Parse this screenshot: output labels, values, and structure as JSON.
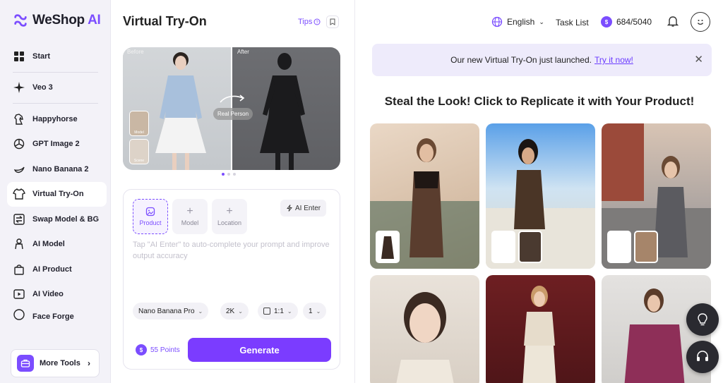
{
  "app": {
    "logo_text": "WeShop",
    "logo_ai": "AI",
    "brand_color": "#7b4dff"
  },
  "sidebar": {
    "items": [
      {
        "label": "Start",
        "icon": "grid-icon"
      },
      {
        "label": "Veo 3",
        "icon": "sparkle-icon"
      },
      {
        "label": "Happyhorse",
        "icon": "horse-icon"
      },
      {
        "label": "GPT Image 2",
        "icon": "openai-icon"
      },
      {
        "label": "Nano Banana 2",
        "icon": "banana-icon"
      },
      {
        "label": "Virtual Try-On",
        "icon": "shirt-icon",
        "active": true
      },
      {
        "label": "Swap Model & BG",
        "icon": "swap-icon"
      },
      {
        "label": "AI Model",
        "icon": "person-icon"
      },
      {
        "label": "AI Product",
        "icon": "bag-icon"
      },
      {
        "label": "AI Video",
        "icon": "video-icon"
      },
      {
        "label": "Face Forge",
        "icon": "face-icon"
      }
    ],
    "more_tools_label": "More Tools"
  },
  "panel": {
    "title": "Virtual Try-On",
    "tips_label": "Tips",
    "preview": {
      "before_label": "Before",
      "after_label": "After",
      "real_person_label": "Real Person",
      "model_thumb_label": "Model",
      "scene_thumb_label": "Scene"
    },
    "slots": [
      {
        "label": "Product",
        "active": true
      },
      {
        "label": "Model",
        "active": false
      },
      {
        "label": "Location",
        "active": false
      }
    ],
    "ai_enter_label": "AI Enter",
    "prompt_placeholder": "Tap \"AI Enter\" to auto-complete your prompt and improve output accuracy",
    "options": {
      "model": "Nano Banana Pro",
      "resolution": "2K",
      "ratio": "1:1",
      "count": "1"
    },
    "points_label": "55 Points",
    "generate_label": "Generate"
  },
  "topbar": {
    "language": "English",
    "task_list": "Task List",
    "credits": "684/5040"
  },
  "banner": {
    "text": "Our new Virtual Try-On just launched.",
    "link": "Try it now!"
  },
  "gallery": {
    "title": "Steal the Look! Click to Replicate it with Your Product!"
  }
}
